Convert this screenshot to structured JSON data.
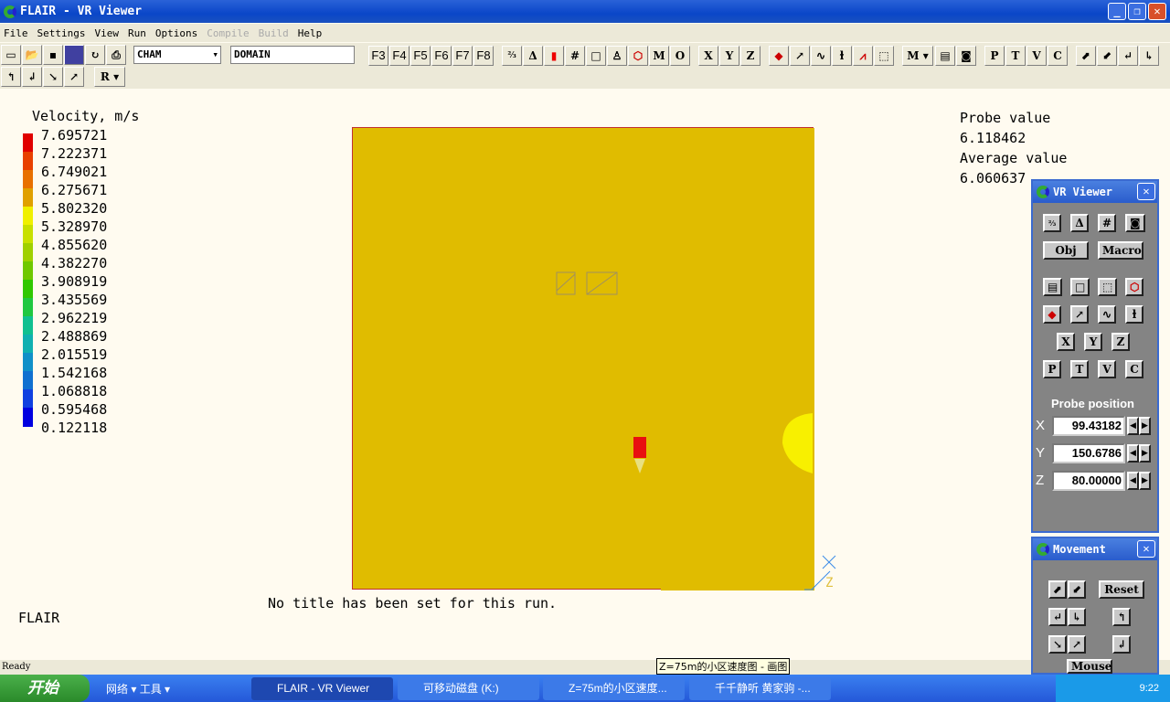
{
  "window": {
    "title": "FLAIR - VR Viewer"
  },
  "menu": [
    "File",
    "Settings",
    "View",
    "Run",
    "Options",
    "Compile",
    "Build",
    "Help"
  ],
  "menu_disabled": [
    "Compile",
    "Build"
  ],
  "toolbar": {
    "combo1": "CHAM",
    "combo2": "DOMAIN",
    "fkeys": [
      "F3",
      "F4",
      "F5",
      "F6",
      "F7",
      "F8"
    ],
    "letters1": [
      "M",
      "O"
    ],
    "axes": [
      "X",
      "Y",
      "Z"
    ],
    "mode": "M",
    "ptvc": [
      "P",
      "T",
      "V",
      "C"
    ],
    "r_combo": "R"
  },
  "legend": {
    "title": "Velocity, m/s",
    "values": [
      "7.695721",
      "7.222371",
      "6.749021",
      "6.275671",
      "5.802320",
      "5.328970",
      "4.855620",
      "4.382270",
      "3.908919",
      "3.435569",
      "2.962219",
      "2.488869",
      "2.015519",
      "1.542168",
      "1.068818",
      "0.595468",
      "0.122118"
    ],
    "colors": [
      "#e00000",
      "#e84000",
      "#e87000",
      "#e0a000",
      "#f0f000",
      "#c8e000",
      "#a0d000",
      "#70c800",
      "#30c800",
      "#20c840",
      "#10c090",
      "#10b0b0",
      "#1090c8",
      "#1070d0",
      "#1040e0",
      "#0000e0"
    ]
  },
  "plot": {
    "fill": "#e0bc00",
    "caption": "No title has been set for this run.",
    "axis_labels": [
      "X",
      "Z"
    ]
  },
  "brand": "FLAIR",
  "probe": {
    "label": "Probe value",
    "value": "6.118462",
    "avg_label": "Average value",
    "avg_value": "6.060637"
  },
  "vr_panel": {
    "title": "VR Viewer",
    "obj": "Obj",
    "macro": "Macro",
    "axes": [
      "X",
      "Y",
      "Z"
    ],
    "ptvc": [
      "P",
      "T",
      "V",
      "C"
    ],
    "probe_position": "Probe position",
    "x": "99.43182",
    "y": "150.6786",
    "z": "80.00000",
    "xl": "X",
    "yl": "Y",
    "zl": "Z"
  },
  "move_panel": {
    "title": "Movement",
    "reset": "Reset",
    "mouse": "Mouse"
  },
  "status": "Ready",
  "tooltip": "Z=75m的小区速度图 - 画图",
  "taskbar": {
    "start": "开始",
    "quick": "网络 ▾ 工具 ▾",
    "tasks": [
      "FLAIR - VR Viewer",
      "可移动磁盘 (K:)",
      "Z=75m的小区速度...",
      "千千静听  黄家驹 -..."
    ],
    "clock": "9:22"
  }
}
